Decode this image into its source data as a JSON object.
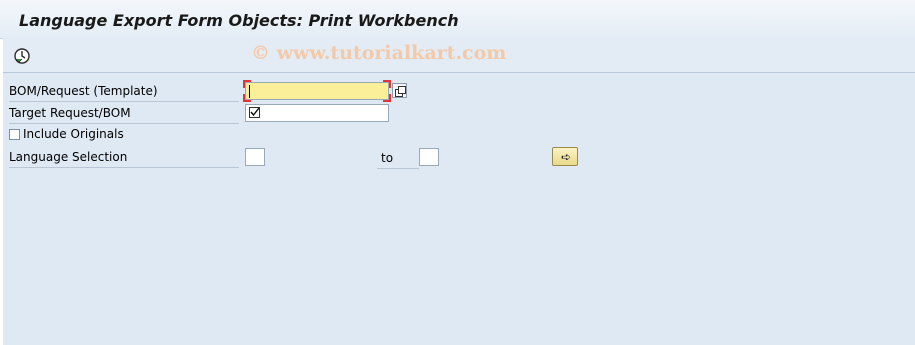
{
  "header": {
    "title": "Language Export Form Objects: Print Workbench"
  },
  "toolbar": {
    "execute_icon": "execute-clock-icon",
    "watermark": "© www.tutorialkart.com"
  },
  "form": {
    "bom_request": {
      "label": "BOM/Request (Template)",
      "value": ""
    },
    "target_request": {
      "label": "Target Request/BOM",
      "value": ""
    },
    "include_originals": {
      "label": "Include Originals",
      "checked": false
    },
    "language_selection": {
      "label": "Language Selection",
      "from": "",
      "to_label": "to",
      "to": ""
    }
  },
  "colors": {
    "required_field": "#fbef99",
    "background": "#dfe9f3",
    "required_marker": "#e2343a"
  }
}
